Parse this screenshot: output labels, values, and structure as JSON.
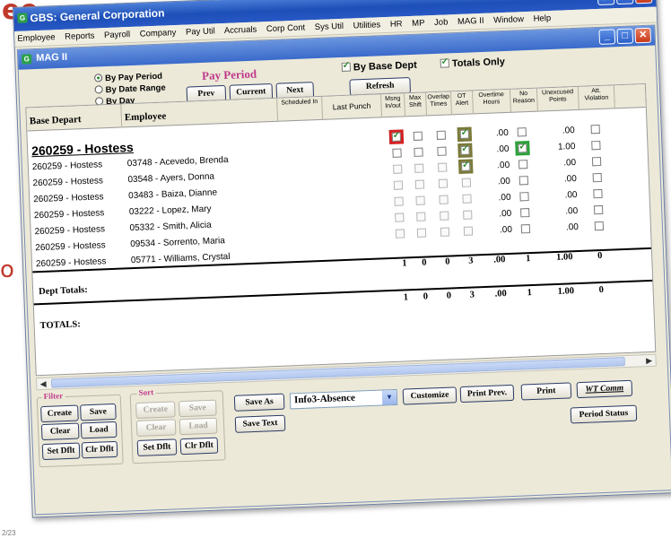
{
  "background": {
    "word": "ee",
    "letter": "o",
    "footnote": "2/23"
  },
  "window": {
    "title": "GBS: General Corporation",
    "menu": [
      "Employee",
      "Reports",
      "Payroll",
      "Company",
      "Pay Util",
      "Accruals",
      "Corp Cont",
      "Sys Util",
      "Utilities",
      "HR",
      "MP",
      "Job",
      "MAG II",
      "Window",
      "Help"
    ]
  },
  "child": {
    "title": "MAG II"
  },
  "period": {
    "options": [
      "By Pay Period",
      "By Date Range",
      "By Day"
    ],
    "selected": "By Pay Period",
    "title": "Pay Period",
    "prev": "Prev",
    "current": "Current",
    "next": "Next",
    "refresh": "Refresh"
  },
  "toggles": {
    "by_base_dept": "By Base Dept",
    "by_base_dept_checked": true,
    "totals_only": "Totals Only",
    "totals_only_checked": true
  },
  "grid": {
    "headers": {
      "base_depart": "Base Depart",
      "employee": "Employee",
      "scheduled": "Scheduled In",
      "last_punch": "Last Punch",
      "missing_in_out": "Msng In/out",
      "max_shift": "Max Shift",
      "overlap_times": "Overlap Times",
      "ot_alert": "OT Alert",
      "overtime_hours": "Overtime Hours",
      "no_reason": "No Reason",
      "unexcused_points": "Unexcused Points",
      "att_violation": "Att. Violation"
    },
    "section": "260259 - Hostess",
    "rows": [
      {
        "dept": "",
        "employee": "",
        "missing": "red-on",
        "max": "off",
        "overlap": "off",
        "ot": "hl-on",
        "ot_hours": ".00",
        "no_reason": "off",
        "points": ".00",
        "att": "off"
      },
      {
        "dept": "260259 - Hostess",
        "employee": "03748 - Acevedo, Brenda",
        "missing": "off",
        "max": "off",
        "overlap": "off",
        "ot": "hl-on",
        "ot_hours": ".00",
        "no_reason": "green-on",
        "points": "1.00",
        "att": "off"
      },
      {
        "dept": "260259 - Hostess",
        "employee": "03548 - Ayers, Donna",
        "missing": "dim",
        "max": "dim",
        "overlap": "dim",
        "ot": "hl-on",
        "ot_hours": ".00",
        "no_reason": "off",
        "points": ".00",
        "att": "off"
      },
      {
        "dept": "260259 - Hostess",
        "employee": "03483 - Baiza, Dianne",
        "missing": "dim",
        "max": "dim",
        "overlap": "dim",
        "ot": "dim",
        "ot_hours": ".00",
        "no_reason": "off",
        "points": ".00",
        "att": "off"
      },
      {
        "dept": "260259 - Hostess",
        "employee": "03222 - Lopez, Mary",
        "missing": "dim",
        "max": "dim",
        "overlap": "dim",
        "ot": "dim",
        "ot_hours": ".00",
        "no_reason": "off",
        "points": ".00",
        "att": "off"
      },
      {
        "dept": "260259 - Hostess",
        "employee": "05332 - Smith, Alicia",
        "missing": "dim",
        "max": "dim",
        "overlap": "dim",
        "ot": "dim",
        "ot_hours": ".00",
        "no_reason": "off",
        "points": ".00",
        "att": "off"
      },
      {
        "dept": "260259 - Hostess",
        "employee": "09534 - Sorrento, Maria",
        "missing": "dim",
        "max": "dim",
        "overlap": "dim",
        "ot": "dim",
        "ot_hours": ".00",
        "no_reason": "off",
        "points": ".00",
        "att": "off"
      },
      {
        "dept": "260259 - Hostess",
        "employee": "05771 - Williams, Crystal",
        "missing": "",
        "max": "",
        "overlap": "",
        "ot": "",
        "ot_hours": "",
        "no_reason": "",
        "points": "",
        "att": ""
      }
    ],
    "subtotals": {
      "missing": "1",
      "max": "0",
      "overlap": "0",
      "ot": "3",
      "ot_hours": ".00",
      "no_reason": "1",
      "points": "1.00",
      "att": "0"
    },
    "dept_totals_label": "Dept Totals:",
    "dept_totals": {
      "missing": "1",
      "max": "0",
      "overlap": "0",
      "ot": "3",
      "ot_hours": ".00",
      "no_reason": "1",
      "points": "1.00",
      "att": "0"
    },
    "totals_label": "TOTALS:"
  },
  "filter": {
    "label": "Filter",
    "create": "Create",
    "save": "Save",
    "clear": "Clear",
    "load": "Load",
    "set_dflt": "Set Dflt",
    "clr_dflt": "Clr Dflt"
  },
  "sort": {
    "label": "Sort",
    "create": "Create",
    "save": "Save",
    "clear": "Clear",
    "load": "Load",
    "set_dflt": "Set Dflt",
    "clr_dflt": "Clr Dflt"
  },
  "actions": {
    "save_as": "Save As",
    "save_text": "Save Text",
    "report_select": "Info3-Absence",
    "customize": "Customize",
    "print_prev": "Print Prev.",
    "print": "Print",
    "wt_comm": "WT Comm",
    "period_status": "Period Status"
  }
}
